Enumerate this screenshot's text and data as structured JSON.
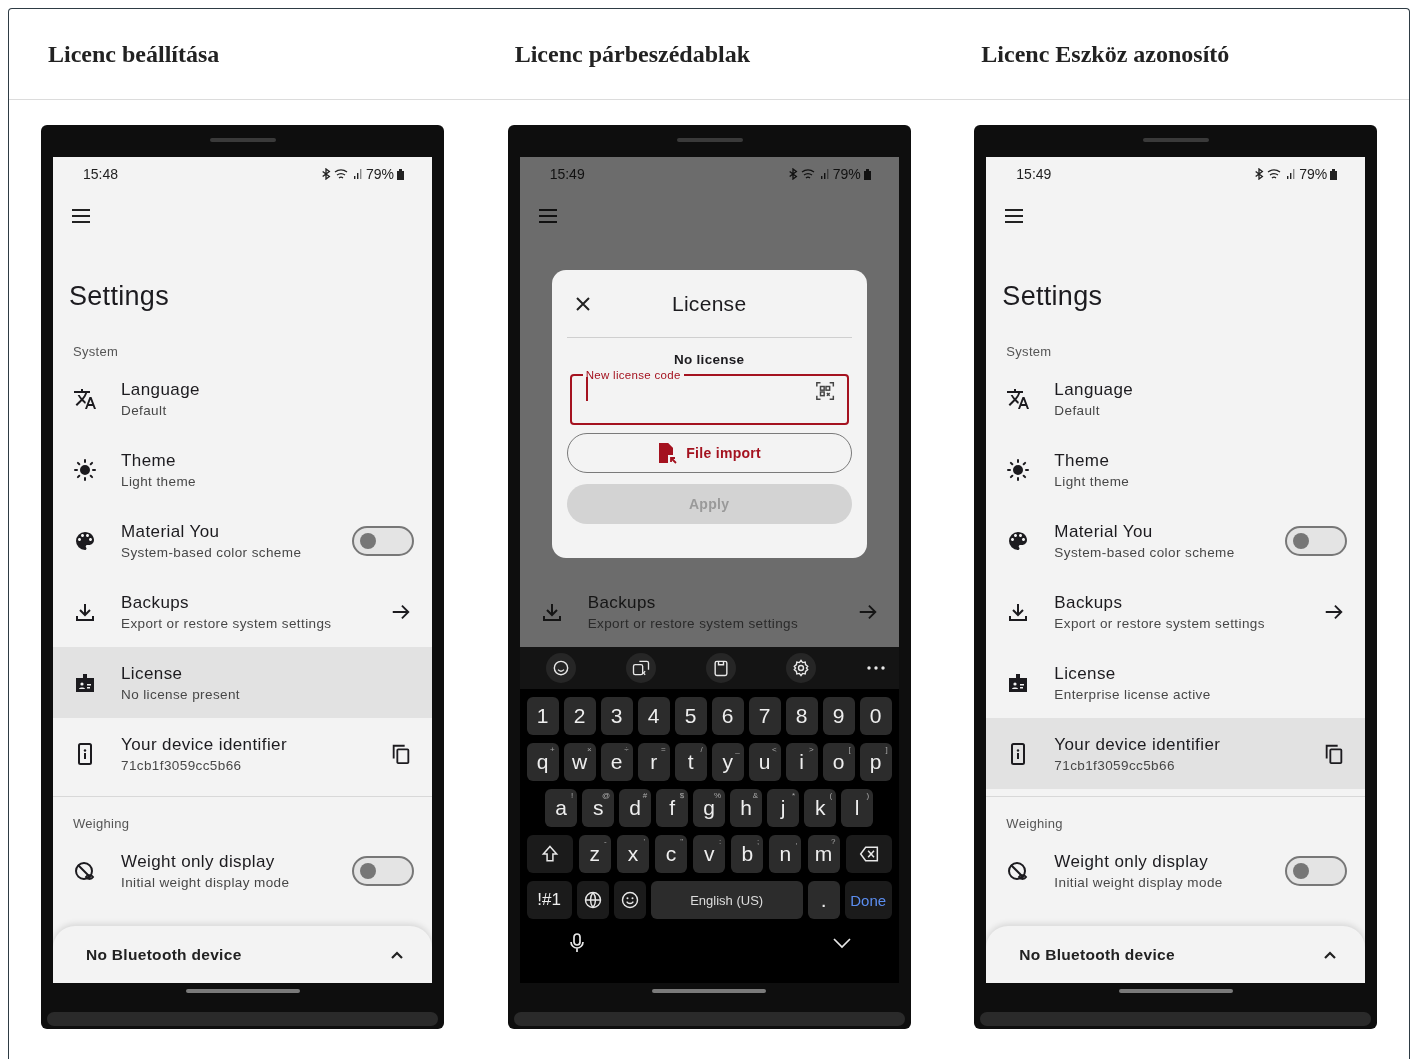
{
  "headings": [
    "Licenc beállítása",
    "Licenc párbeszédablak",
    "Licenc Eszköz azonosító"
  ],
  "phones": [
    {
      "kind": "settings",
      "status_bar": {
        "time": "15:48",
        "battery": "79%"
      },
      "title": "Settings",
      "sections": [
        {
          "label": "System",
          "items": [
            {
              "kind": "plain",
              "title": "Language",
              "subtitle": "Default",
              "selected": false
            },
            {
              "kind": "plain",
              "title": "Theme",
              "subtitle": "Light theme",
              "selected": false
            },
            {
              "kind": "toggle",
              "title": "Material You",
              "subtitle": "System-based color scheme",
              "on": false,
              "selected": false
            },
            {
              "kind": "arrow",
              "title": "Backups",
              "subtitle": "Export or restore system settings",
              "selected": false
            },
            {
              "kind": "plain",
              "title": "License",
              "subtitle": "No license present",
              "selected": true
            },
            {
              "kind": "copy",
              "title": "Your device identifier",
              "subtitle": "71cb1f3059cc5b66",
              "selected": false
            }
          ]
        },
        {
          "label": "Weighing",
          "items": [
            {
              "kind": "toggle",
              "title": "Weight only display",
              "subtitle": "Initial weight display mode",
              "on": false,
              "selected": false
            }
          ]
        }
      ],
      "bottom_sheet": {
        "label": "No Bluetooth device"
      }
    },
    {
      "kind": "dialog",
      "status_bar": {
        "time": "15:49",
        "battery": "79%"
      },
      "backdrop_items": [
        {
          "kind": "arrow",
          "title": "Backups",
          "subtitle": "Export or restore system settings"
        }
      ],
      "dialog": {
        "title": "License",
        "status": "No license",
        "field": {
          "label": "New license code"
        },
        "buttons": [
          {
            "label": "File import",
            "kind": "outlined",
            "disabled": false
          },
          {
            "label": "Apply",
            "kind": "filled",
            "disabled": true
          }
        ]
      },
      "keyboard": {
        "rows": [
          {
            "keys": [
              {
                "kind": "char",
                "label": "1"
              },
              {
                "kind": "char",
                "label": "2"
              },
              {
                "kind": "char",
                "label": "3"
              },
              {
                "kind": "char",
                "label": "4"
              },
              {
                "kind": "char",
                "label": "5"
              },
              {
                "kind": "char",
                "label": "6"
              },
              {
                "kind": "char",
                "label": "7"
              },
              {
                "kind": "char",
                "label": "8"
              },
              {
                "kind": "char",
                "label": "9"
              },
              {
                "kind": "char",
                "label": "0"
              }
            ]
          },
          {
            "keys": [
              {
                "kind": "char",
                "label": "q",
                "hint": "+"
              },
              {
                "kind": "char",
                "label": "w",
                "hint": "×"
              },
              {
                "kind": "char",
                "label": "e",
                "hint": "÷"
              },
              {
                "kind": "char",
                "label": "r",
                "hint": "="
              },
              {
                "kind": "char",
                "label": "t",
                "hint": "/"
              },
              {
                "kind": "char",
                "label": "y",
                "hint": "_"
              },
              {
                "kind": "char",
                "label": "u",
                "hint": "<"
              },
              {
                "kind": "char",
                "label": "i",
                "hint": ">"
              },
              {
                "kind": "char",
                "label": "o",
                "hint": "["
              },
              {
                "kind": "char",
                "label": "p",
                "hint": "]"
              }
            ]
          },
          {
            "keys": [
              {
                "kind": "char",
                "label": "a",
                "hint": "!"
              },
              {
                "kind": "char",
                "label": "s",
                "hint": "@"
              },
              {
                "kind": "char",
                "label": "d",
                "hint": "#"
              },
              {
                "kind": "char",
                "label": "f",
                "hint": "$"
              },
              {
                "kind": "char",
                "label": "g",
                "hint": "%"
              },
              {
                "kind": "char",
                "label": "h",
                "hint": "&"
              },
              {
                "kind": "char",
                "label": "j",
                "hint": "*"
              },
              {
                "kind": "char",
                "label": "k",
                "hint": "("
              },
              {
                "kind": "char",
                "label": "l",
                "hint": ")"
              }
            ]
          },
          {
            "keys": [
              {
                "kind": "shift"
              },
              {
                "kind": "char",
                "label": "z",
                "hint": "-"
              },
              {
                "kind": "char",
                "label": "x",
                "hint": "'"
              },
              {
                "kind": "char",
                "label": "c",
                "hint": "\""
              },
              {
                "kind": "char",
                "label": "v",
                "hint": ":"
              },
              {
                "kind": "char",
                "label": "b",
                "hint": ";"
              },
              {
                "kind": "char",
                "label": "n",
                "hint": ","
              },
              {
                "kind": "char",
                "label": "m",
                "hint": "?"
              },
              {
                "kind": "backspace"
              }
            ]
          },
          {
            "keys": [
              {
                "kind": "symbols",
                "label": "!#1"
              },
              {
                "kind": "globe"
              },
              {
                "kind": "emoji"
              },
              {
                "kind": "space",
                "label": "English (US)"
              },
              {
                "kind": "char",
                "label": "."
              },
              {
                "kind": "done",
                "label": "Done"
              }
            ]
          }
        ]
      }
    },
    {
      "kind": "settings",
      "status_bar": {
        "time": "15:49",
        "battery": "79%"
      },
      "title": "Settings",
      "sections": [
        {
          "label": "System",
          "items": [
            {
              "kind": "plain",
              "title": "Language",
              "subtitle": "Default",
              "selected": false
            },
            {
              "kind": "plain",
              "title": "Theme",
              "subtitle": "Light theme",
              "selected": false
            },
            {
              "kind": "toggle",
              "title": "Material You",
              "subtitle": "System-based color scheme",
              "on": false,
              "selected": false
            },
            {
              "kind": "arrow",
              "title": "Backups",
              "subtitle": "Export or restore system settings",
              "selected": false
            },
            {
              "kind": "plain",
              "title": "License",
              "subtitle": "Enterprise license active",
              "selected": false
            },
            {
              "kind": "copy",
              "title": "Your device identifier",
              "subtitle": "71cb1f3059cc5b66",
              "selected": true
            }
          ]
        },
        {
          "label": "Weighing",
          "items": [
            {
              "kind": "toggle",
              "title": "Weight only display",
              "subtitle": "Initial weight display mode",
              "on": false,
              "selected": false
            }
          ]
        }
      ],
      "bottom_sheet": {
        "label": "No Bluetooth device"
      }
    }
  ]
}
